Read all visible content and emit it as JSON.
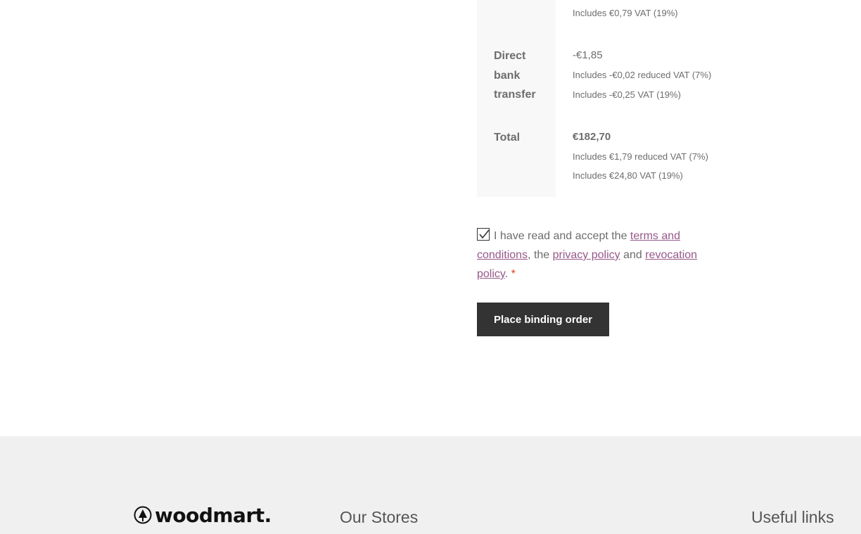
{
  "order_totals": {
    "top_note": "Includes €0,79 VAT (19%)",
    "payment": {
      "label": "Direct bank transfer",
      "value": "-€1,85",
      "notes": [
        "Includes -€0,02 reduced VAT (7%)",
        "Includes -€0,25 VAT (19%)"
      ]
    },
    "total": {
      "label": "Total",
      "value": "€182,70",
      "notes": [
        "Includes €1,79 reduced VAT (7%)",
        "Includes €24,80 VAT (19%)"
      ]
    }
  },
  "terms": {
    "checked": true,
    "prefix": "I have read and accept the ",
    "terms_link": "terms and conditions",
    "middle1": ", the ",
    "privacy_link": "privacy policy",
    "middle2": " and ",
    "revocation_link": "revocation policy",
    "suffix": ". ",
    "required_mark": "*"
  },
  "place_order": {
    "label": "Place binding order"
  },
  "footer": {
    "logo_text": "woodmart.",
    "col1_title": "Our Stores",
    "col2_title": "Useful links"
  },
  "colors": {
    "link": "#96588a",
    "button_bg": "#333333",
    "footer_bg": "#f0f0f0",
    "required": "#e2401c"
  }
}
